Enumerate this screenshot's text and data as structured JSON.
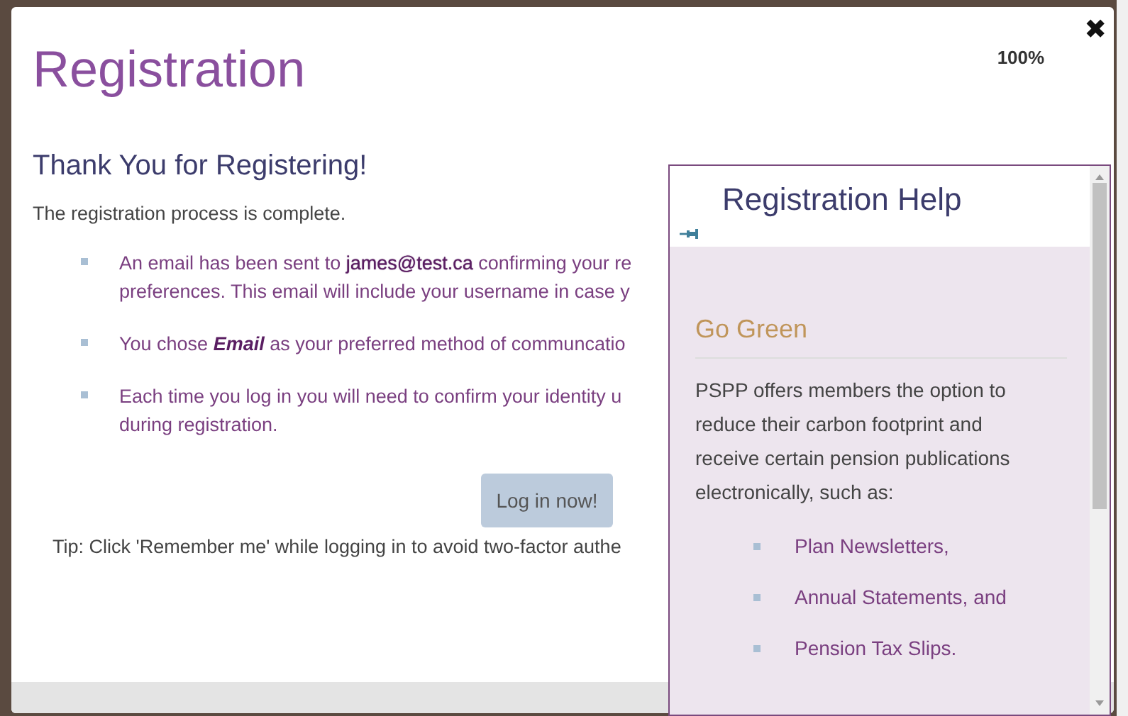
{
  "modal": {
    "title": "Registration",
    "zoom": "100%",
    "close": "✖",
    "heading": "Thank You for Registering!",
    "intro": "The registration process is complete.",
    "bullets": [
      {
        "lines": [
          "An email has been sent to **james@test.ca** confirming your re",
          "preferences. This email will include your username in case y"
        ]
      },
      {
        "lines": [
          "You chose *Email* as your preferred method of communcatio"
        ]
      },
      {
        "lines": [
          "Each time you log in you will need to confirm your identity u",
          "during registration."
        ]
      }
    ],
    "button": "Log in now!",
    "tip": "Tip: Click 'Remember me' while logging in to avoid two-factor authe"
  },
  "help_panel": {
    "title": "Registration Help",
    "section": "Go Green",
    "paragraph": "PSPP offers members the option to reduce their carbon footprint and receive certain pension publications electronically, such as:",
    "items": [
      "Plan Newsletters,",
      "Annual Statements, and",
      "Pension Tax Slips."
    ]
  }
}
